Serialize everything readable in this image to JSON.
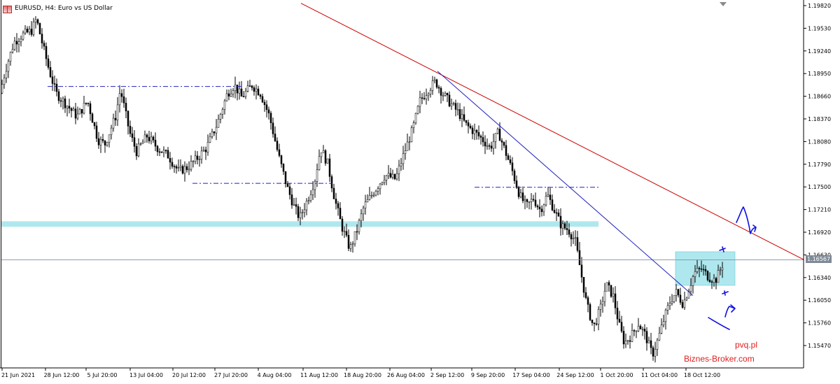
{
  "chart_title": "EURUSD, H4:  Euro vs US Dollar",
  "current_price": "1.16567",
  "watermark_site": "pvq.pl",
  "watermark_brand": "Biznes-Broker.com",
  "colors": {
    "candle": "#000000",
    "candle_fill": "#ffffff",
    "trend_red": "#cc0000",
    "trend_blue": "#2020c0",
    "level_zone": "#aee8ee",
    "current_price_line": "#8090a8",
    "drawing_blue": "#1010e0"
  },
  "chart_data": {
    "type": "candlestick",
    "symbol": "EURUSD",
    "timeframe": "H4",
    "ylim": [
      1.1525,
      1.1985
    ],
    "y_ticks": [
      "1.19820",
      "1.19530",
      "1.19240",
      "1.18950",
      "1.18660",
      "1.18370",
      "1.18080",
      "1.17790",
      "1.17500",
      "1.17210",
      "1.16920",
      "1.16630",
      "1.16340",
      "1.16050",
      "1.15760",
      "1.15470"
    ],
    "x_ticks": [
      "21 Jun 2021",
      "28 Jun 12:00",
      "5 Jul 20:00",
      "13 Jul 04:00",
      "20 Jul 12:00",
      "27 Jul 20:00",
      "4 Aug 04:00",
      "11 Aug 12:00",
      "18 Aug 20:00",
      "26 Aug 04:00",
      "2 Sep 12:00",
      "9 Sep 20:00",
      "17 Sep 04:00",
      "24 Sep 12:00",
      "1 Oct 20:00",
      "11 Oct 04:00",
      "18 Oct 12:00"
    ],
    "price_path": [
      [
        0,
        1.187
      ],
      [
        8,
        1.19
      ],
      [
        20,
        1.1935
      ],
      [
        33,
        1.1945
      ],
      [
        45,
        1.195
      ],
      [
        52,
        1.1965
      ],
      [
        60,
        1.1935
      ],
      [
        70,
        1.19
      ],
      [
        80,
        1.187
      ],
      [
        95,
        1.1855
      ],
      [
        110,
        1.184
      ],
      [
        125,
        1.186
      ],
      [
        140,
        1.181
      ],
      [
        150,
        1.1805
      ],
      [
        165,
        1.184
      ],
      [
        172,
        1.1875
      ],
      [
        185,
        1.182
      ],
      [
        195,
        1.1795
      ],
      [
        210,
        1.1815
      ],
      [
        225,
        1.18
      ],
      [
        240,
        1.179
      ],
      [
        255,
        1.177
      ],
      [
        268,
        1.1775
      ],
      [
        280,
        1.1785
      ],
      [
        295,
        1.18
      ],
      [
        310,
        1.183
      ],
      [
        325,
        1.187
      ],
      [
        335,
        1.188
      ],
      [
        345,
        1.1865
      ],
      [
        360,
        1.188
      ],
      [
        372,
        1.187
      ],
      [
        385,
        1.184
      ],
      [
        398,
        1.179
      ],
      [
        410,
        1.175
      ],
      [
        420,
        1.1725
      ],
      [
        428,
        1.171
      ],
      [
        440,
        1.1735
      ],
      [
        450,
        1.176
      ],
      [
        458,
        1.18
      ],
      [
        468,
        1.178
      ],
      [
        478,
        1.1735
      ],
      [
        488,
        1.17
      ],
      [
        500,
        1.167
      ],
      [
        510,
        1.1695
      ],
      [
        520,
        1.1725
      ],
      [
        535,
        1.1745
      ],
      [
        550,
        1.1765
      ],
      [
        565,
        1.176
      ],
      [
        578,
        1.1795
      ],
      [
        590,
        1.1825
      ],
      [
        600,
        1.186
      ],
      [
        612,
        1.1875
      ],
      [
        622,
        1.1885
      ],
      [
        632,
        1.187
      ],
      [
        645,
        1.1855
      ],
      [
        655,
        1.1845
      ],
      [
        665,
        1.183
      ],
      [
        678,
        1.182
      ],
      [
        690,
        1.181
      ],
      [
        700,
        1.18
      ],
      [
        712,
        1.182
      ],
      [
        722,
        1.1795
      ],
      [
        732,
        1.177
      ],
      [
        742,
        1.174
      ],
      [
        752,
        1.1725
      ],
      [
        762,
        1.1735
      ],
      [
        772,
        1.172
      ],
      [
        782,
        1.174
      ],
      [
        792,
        1.172
      ],
      [
        802,
        1.17
      ],
      [
        812,
        1.1695
      ],
      [
        822,
        1.168
      ],
      [
        830,
        1.164
      ],
      [
        838,
        1.16
      ],
      [
        848,
        1.157
      ],
      [
        858,
        1.1595
      ],
      [
        866,
        1.1625
      ],
      [
        876,
        1.161
      ],
      [
        884,
        1.1575
      ],
      [
        892,
        1.155
      ],
      [
        902,
        1.156
      ],
      [
        912,
        1.1575
      ],
      [
        922,
        1.156
      ],
      [
        932,
        1.1535
      ],
      [
        940,
        1.1555
      ],
      [
        950,
        1.1585
      ],
      [
        958,
        1.1605
      ],
      [
        966,
        1.1615
      ],
      [
        976,
        1.16
      ],
      [
        984,
        1.162
      ],
      [
        992,
        1.164
      ],
      [
        1002,
        1.1645
      ],
      [
        1012,
        1.1635
      ],
      [
        1022,
        1.163
      ],
      [
        1032,
        1.165
      ]
    ],
    "annotations": {
      "red_trendline": [
        [
          430,
          1.1985
        ],
        [
          1148,
          1.1657
        ]
      ],
      "blue_trendline": [
        [
          625,
          1.1898
        ],
        [
          990,
          1.1611
        ]
      ],
      "blue_resistance_1": [
        [
          68,
          1.18785
        ],
        [
          345,
          1.18785
        ]
      ],
      "blue_resistance_2": [
        [
          275,
          1.17545
        ],
        [
          475,
          1.17545
        ]
      ],
      "blue_resistance_3": [
        [
          678,
          1.17495
        ],
        [
          858,
          1.17495
        ]
      ],
      "cyan_zone": [
        [
          2,
          1.1706
        ],
        [
          855,
          1.1699
        ]
      ],
      "cyan_box": [
        [
          965,
          1.1667
        ],
        [
          1050,
          1.1624
        ]
      ],
      "current_price": 1.16567
    }
  }
}
